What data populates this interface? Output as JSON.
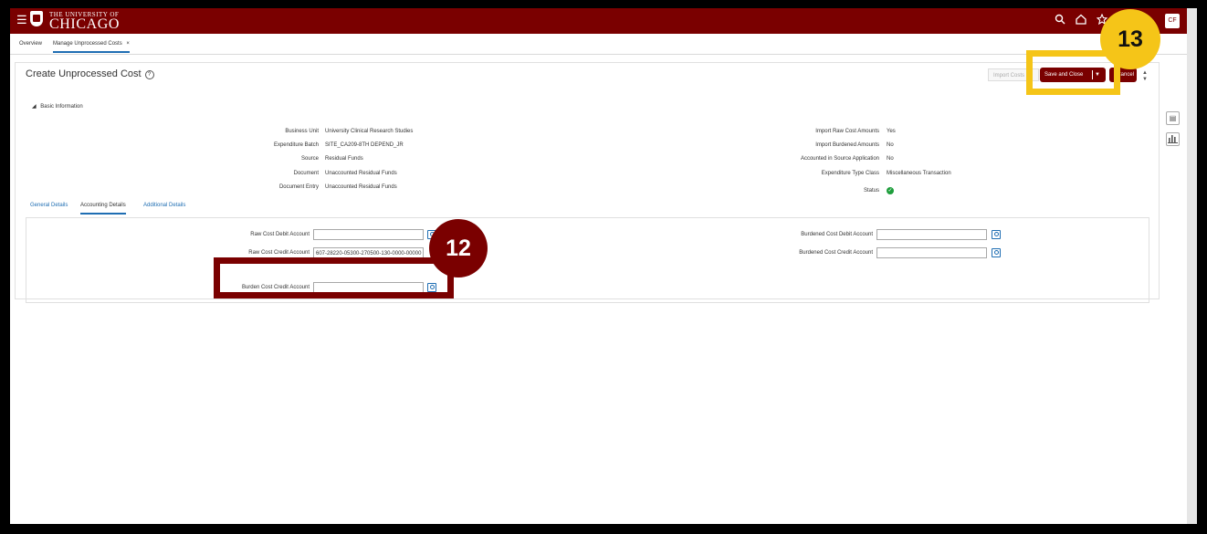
{
  "header": {
    "logo_line1": "THE UNIVERSITY OF",
    "logo_line2": "CHICAGO",
    "avatar_initials": "CF"
  },
  "tabs": [
    {
      "label": "Overview"
    },
    {
      "label": "Manage Unprocessed Costs"
    }
  ],
  "page": {
    "title": "Create Unprocessed Cost",
    "buttons": {
      "import": "Import Costs",
      "save_and_close": "Save and Close",
      "cancel": "Cancel"
    }
  },
  "basic_info": {
    "section_label": "Basic Information",
    "left": [
      {
        "label": "Business Unit",
        "value": "University Clinical Research Studies"
      },
      {
        "label": "Expenditure Batch",
        "value": "SITE_CA209-8TH DEPEND_JR"
      },
      {
        "label": "Source",
        "value": "Residual Funds"
      },
      {
        "label": "Document",
        "value": "Unaccounted Residual Funds"
      },
      {
        "label": "Document Entry",
        "value": "Unaccounted Residual Funds"
      }
    ],
    "right": [
      {
        "label": "Import Raw Cost Amounts",
        "value": "Yes"
      },
      {
        "label": "Import Burdened Amounts",
        "value": "No"
      },
      {
        "label": "Accounted in Source Application",
        "value": "No"
      },
      {
        "label": "Expenditure Type Class",
        "value": "Miscellaneous Transaction"
      },
      {
        "label": "Status",
        "value": ""
      }
    ]
  },
  "sub_tabs": [
    {
      "label": "General Details"
    },
    {
      "label": "Accounting Details"
    },
    {
      "label": "Additional Details"
    }
  ],
  "accounting": {
    "raw_cost_debit": {
      "label": "Raw Cost Debit Account",
      "value": ""
    },
    "raw_cost_credit": {
      "label": "Raw Cost Credit Account",
      "value": "607-28220-05300-270500-130-0000-00000"
    },
    "burden_cost_credit": {
      "label": "Burden Cost Credit Account",
      "value": ""
    },
    "burdened_cost_debit": {
      "label": "Burdened Cost Debit Account",
      "value": ""
    },
    "burdened_cost_credit": {
      "label": "Burdened Cost Credit Account",
      "value": ""
    }
  },
  "callouts": [
    {
      "number": "12",
      "color": "#7a0000"
    },
    {
      "number": "13",
      "color": "#f5c518"
    }
  ],
  "colors": {
    "brand": "#7a0000",
    "link": "#1f6eb3",
    "status_ok": "#1e9e3c",
    "highlight": "#f5c518"
  }
}
